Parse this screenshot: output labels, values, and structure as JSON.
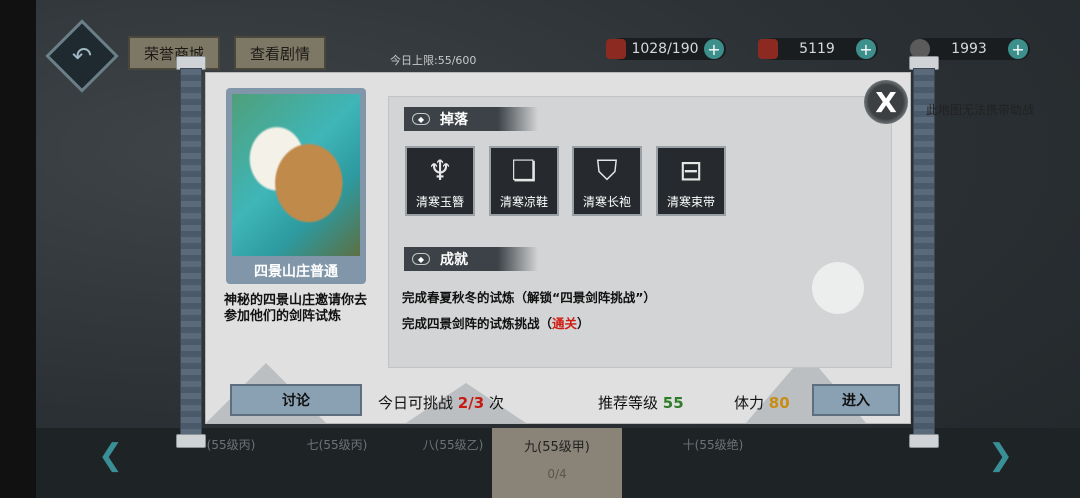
{
  "top_bar": {
    "honor_shop": "荣誉商城",
    "view_story": "查看剧情",
    "daily_limit": "今日上限:55/600",
    "resources": [
      {
        "icon": "stamina-icon",
        "value": "1028/190"
      },
      {
        "icon": "currency-icon",
        "value": "5119"
      },
      {
        "icon": "ingot-icon",
        "value": "1993"
      }
    ]
  },
  "bottom_tabs": [
    {
      "label": "(55级丙)",
      "sub": ""
    },
    {
      "label": "七(55级丙)",
      "sub": ""
    },
    {
      "label": "八(55级乙)",
      "sub": ""
    },
    {
      "label": "九(55级甲)",
      "sub": "0/4"
    },
    {
      "label": "十(55级绝)",
      "sub": ""
    }
  ],
  "dialog": {
    "map_name": "四景山庄普通",
    "description": "神秘的四景山庄邀请你去参加他们的剑阵试炼",
    "no_assist_note": "此地图无法携带助战",
    "drops_label": "掉落",
    "drops": [
      {
        "label": "清寒玉簪",
        "icon": "hairpin-icon",
        "glyph": "♆"
      },
      {
        "label": "清寒凉鞋",
        "icon": "boots-icon",
        "glyph": "❏"
      },
      {
        "label": "清寒长袍",
        "icon": "robe-icon",
        "glyph": "⛉"
      },
      {
        "label": "清寒束带",
        "icon": "belt-icon",
        "glyph": "⊟"
      }
    ],
    "achievements_label": "成就",
    "achievements": [
      {
        "text": "完成春夏秋冬的试炼（解锁“四景剑阵挑战”）",
        "status": ""
      },
      {
        "text": "完成四景剑阵的试炼挑战（",
        "status": "通关",
        "suffix": "）"
      }
    ],
    "discuss_button": "讨论",
    "challenge_prefix": "今日可挑战",
    "challenge_count": "2/3",
    "challenge_suffix": "次",
    "recommended_label": "推荐等级",
    "recommended_level": "55",
    "stamina_label": "体力",
    "stamina_cost": "80",
    "enter_button": "进入",
    "close_glyph": "X"
  },
  "colors": {
    "accent_red": "#c71a12",
    "accent_green": "#2f7d2a",
    "accent_gold": "#c98c14",
    "button": "#8aa0b3"
  }
}
